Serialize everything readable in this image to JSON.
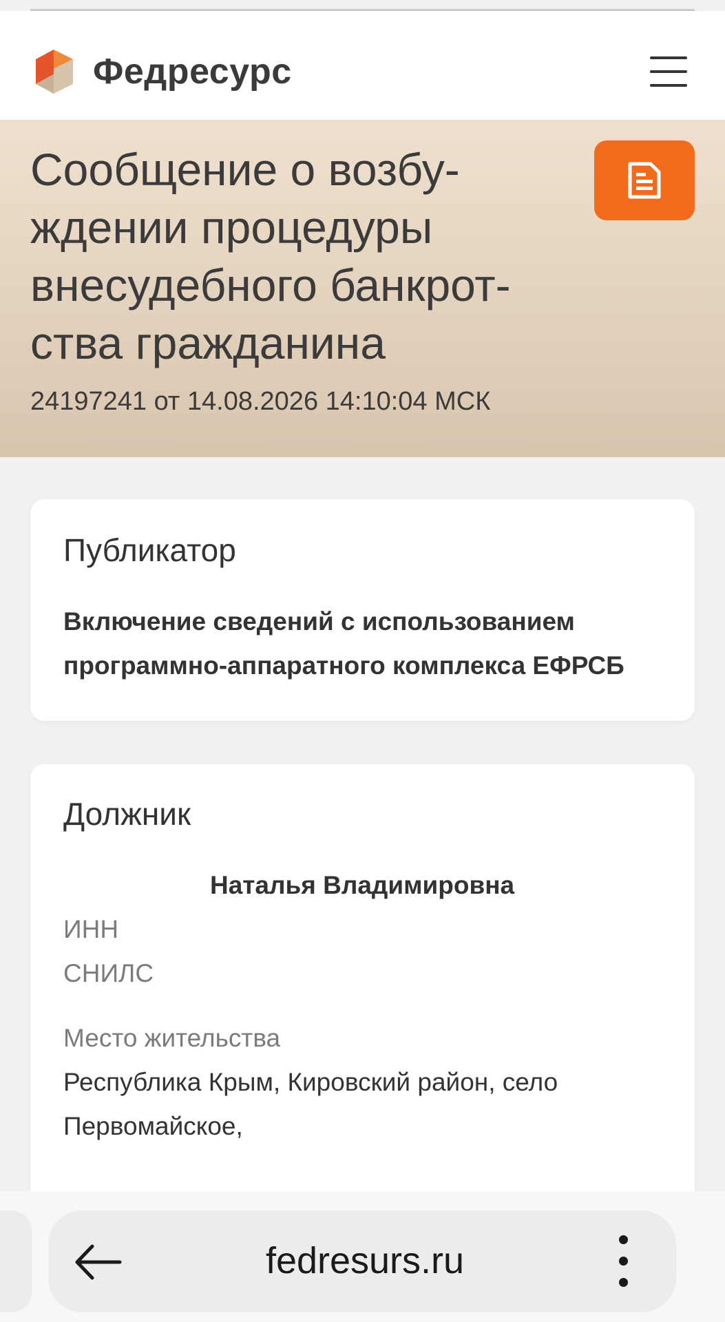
{
  "header": {
    "logo_text": "Федресурс",
    "menu_icon": "hamburger-menu-icon",
    "accent_colors": [
      "#e5532a",
      "#f08a3b",
      "#c9b29a"
    ]
  },
  "hero": {
    "title_lines": [
      "Сообщение о возбу-",
      "ждении процедуры",
      "внесудебного банкрот-",
      "ства гражданина"
    ],
    "meta": "24197241 от 14.08.2026 14:10:04 МСК",
    "document_icon": "document-icon",
    "accent_color": "#f26a1b"
  },
  "publisher": {
    "heading": "Публикатор",
    "lines": [
      "Включение сведений с использованием",
      "программно-аппаратного комплекса ЕФРСБ"
    ]
  },
  "debtor": {
    "heading": "Должник",
    "name": "Наталья Владимировна",
    "inn_label": "ИНН",
    "snils_label": "СНИЛС",
    "residence_label": "Место жительства",
    "residence_lines": [
      "Республика Крым, Кировский район, село",
      "Первомайское,"
    ]
  },
  "browser": {
    "url": "fedresurs.ru",
    "back_icon": "arrow-left-icon",
    "more_icon": "more-vertical-icon"
  }
}
